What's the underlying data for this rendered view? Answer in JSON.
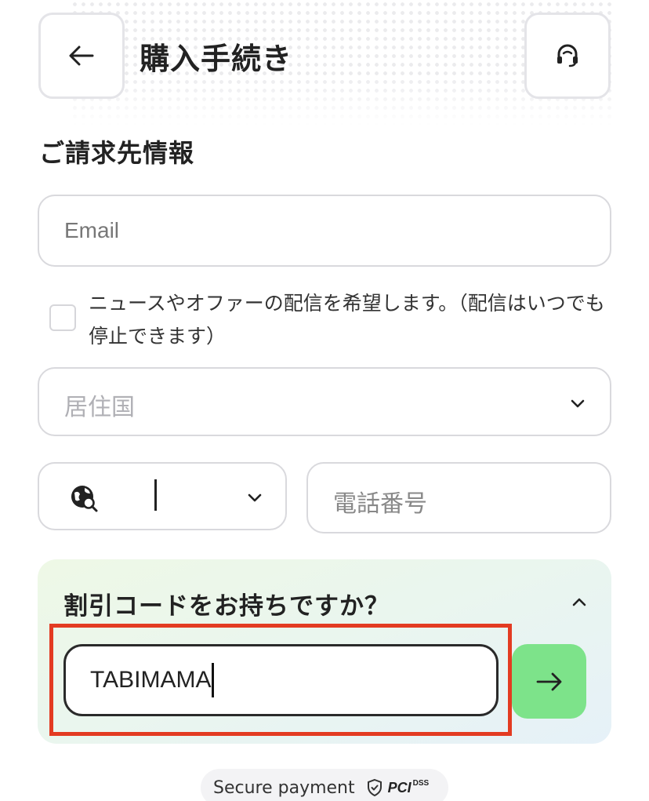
{
  "header": {
    "title": "購入手続き",
    "back_icon": "arrow-left-icon",
    "support_icon": "headset-icon"
  },
  "billing": {
    "section_title": "ご請求先情報",
    "email_placeholder": "Email",
    "email_value": "",
    "newsletter_label": "ニュースやオファーの配信を希望します。（配信はいつでも停止できます）",
    "newsletter_checked": false,
    "country_placeholder": "居住国",
    "phone_code_icon": "globe-search-icon",
    "phone_placeholder": "電話番号"
  },
  "discount": {
    "title": "割引コードをお持ちですか？",
    "expanded": true,
    "code_value": "TABIMAMA",
    "submit_icon": "arrow-right-icon",
    "highlight_color": "#e33b22",
    "submit_color": "#7de38a"
  },
  "footer": {
    "secure_label": "Secure payment",
    "shield_icon": "shield-check-icon",
    "pci_label": "PCI",
    "pci_sub": "DSS"
  }
}
